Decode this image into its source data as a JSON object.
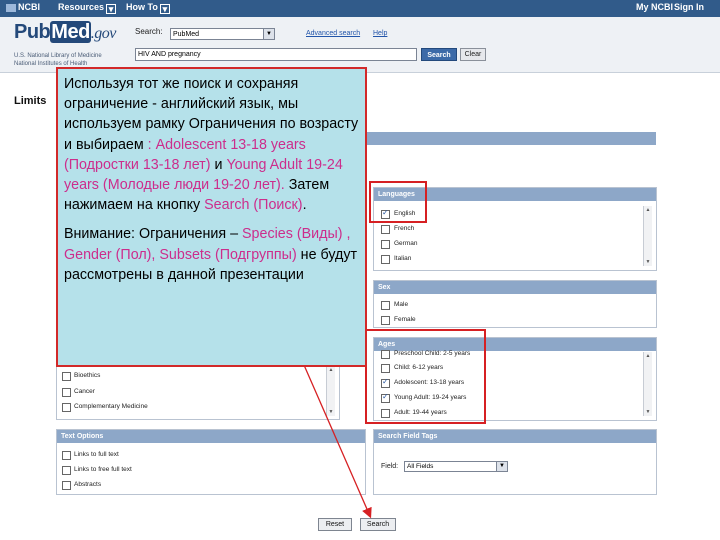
{
  "ncbi_bar": {
    "logo": "NCBI",
    "resources": "Resources",
    "how_to": "How To",
    "my_ncbi": "My NCBI",
    "sign_in": "Sign In"
  },
  "header": {
    "logo_pub": "Pub",
    "logo_med": "Med",
    "logo_gov": ".gov",
    "sub1": "U.S. National Library of Medicine",
    "sub2": "National Institutes of Health",
    "search_label": "Search:",
    "db_value": "PubMed",
    "advanced_link": "Advanced search",
    "help_link": "Help",
    "query_value": "HIV AND pregnancy",
    "search_button": "Search",
    "clear_button": "Clear"
  },
  "page_title": "Limits",
  "languages": {
    "title": "Languages",
    "options": [
      "English",
      "French",
      "German",
      "Italian"
    ],
    "checked": [
      true,
      false,
      false,
      false
    ]
  },
  "sex": {
    "title": "Sex",
    "options": [
      "Male",
      "Female"
    ]
  },
  "ages": {
    "title": "Ages",
    "options": [
      "Preschool Child: 2-5 years",
      "Child: 6-12 years",
      "Adolescent: 13-18 years",
      "Young Adult: 19-24 years",
      "Adult: 19-44 years"
    ],
    "checked": [
      false,
      false,
      true,
      true,
      false
    ]
  },
  "subsets": {
    "options": [
      "Bioethics",
      "Cancer",
      "Complementary Medicine"
    ]
  },
  "text_options": {
    "title": "Text Options",
    "options": [
      "Links to full text",
      "Links to free full text",
      "Abstracts"
    ]
  },
  "search_field_tags": {
    "title": "Search Field Tags",
    "field_label": "Field:",
    "field_value": "All Fields"
  },
  "buttons": {
    "reset": "Reset",
    "search": "Search"
  },
  "info": {
    "p1_a": "Используя тот же поиск и сохраняя ограничение  - английский язык, мы используем рамку Ограничения по возрасту и выбираем ",
    "p1_b": ": Adolescent 13-18 years (Подростки 13-18 лет)",
    "p1_c": " и ",
    "p1_d": "Young Adult 19-24 years (Молодые люди   19-20 лет).",
    "p1_e": " Затем нажимаем на кнопку ",
    "p1_f": "Search (Поиск)",
    "p1_g": ".",
    "p2_a": "Внимание: Ограничения – ",
    "p2_b": "Species (Виды) , Gender (Пол), Subsets (Подгруппы)",
    "p2_c": " не будут рассмотрены в данной презентации"
  },
  "colors": {
    "highlight_red": "#d62023",
    "info_bg": "#b5e1ea",
    "pink_text": "#cc2d8c",
    "panel_header": "#8da7c8",
    "ncbi_bar": "#315b8a"
  }
}
